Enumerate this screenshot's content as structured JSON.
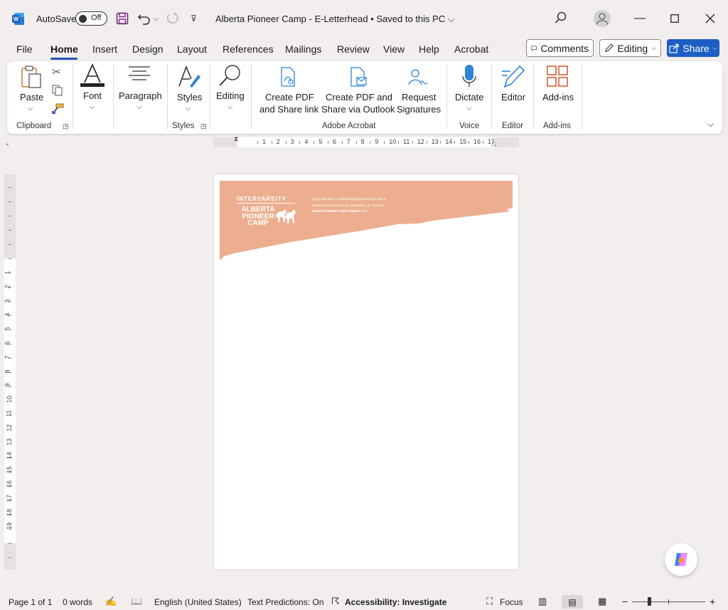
{
  "titlebar": {
    "autosave_label": "AutoSave",
    "autosave_state": "Off",
    "document_title": "Alberta Pioneer Camp - E-Letterhead • Saved to this PC ⌵"
  },
  "menu": {
    "tabs": [
      "File",
      "Home",
      "Insert",
      "Design",
      "Layout",
      "References",
      "Mailings",
      "Review",
      "View",
      "Help",
      "Acrobat"
    ],
    "active_tab": "Home",
    "comments_label": "Comments",
    "editing_label": "Editing",
    "share_label": "Share"
  },
  "ribbon": {
    "paste_label": "Paste",
    "font_label": "Font",
    "paragraph_label": "Paragraph",
    "styles_label": "Styles",
    "editing_label": "Editing",
    "create_pdf_label_1": "Create PDF",
    "create_pdf_label_2": "and Share link",
    "create_pdf_outlook_label_1": "Create PDF and",
    "create_pdf_outlook_label_2": "Share via Outlook",
    "request_sig_label_1": "Request",
    "request_sig_label_2": "Signatures",
    "dictate_label": "Dictate",
    "editor_label": "Editor",
    "addins_label": "Add-ins",
    "groups": {
      "clipboard": "Clipboard",
      "styles": "Styles",
      "adobe": "Adobe Acrobat",
      "voice": "Voice",
      "editor": "Editor",
      "addins": "Add-ins"
    }
  },
  "ruler": {
    "h_numbers": [
      "1",
      "2",
      "3",
      "4",
      "5",
      "6",
      "7",
      "8",
      "9",
      "10",
      "11",
      "12",
      "13",
      "14",
      "15",
      "16",
      "17"
    ],
    "v_numbers": [
      "1",
      "2",
      "3",
      "4",
      "5",
      "6",
      "7",
      "8",
      "9",
      "10",
      "11",
      "12",
      "13",
      "14",
      "15",
      "16",
      "17",
      "18",
      "19"
    ]
  },
  "letterhead": {
    "org_top": "INTERVARSITY",
    "camp_line1": "ALBERTA",
    "camp_line2": "PIONEER",
    "camp_line3": "CAMP",
    "contact_line1": "(403) 938-2560 | registration@pioneercamps.ab.ca",
    "contact_line2": "82034 RANGE ROAD 62, SUNDRE, AB T0M 1X0",
    "contact_line3": "WWW.PIONEERCAMPALBERTA.CA",
    "band_color": "#ecae8f"
  },
  "statusbar": {
    "page": "Page 1 of 1",
    "words": "0 words",
    "language": "English (United States)",
    "predictions": "Text Predictions: On",
    "accessibility": "Accessibility: Investigate",
    "focus": "Focus"
  },
  "colors": {
    "accent": "#1c5fc4",
    "app_bg": "#f3eeee"
  }
}
